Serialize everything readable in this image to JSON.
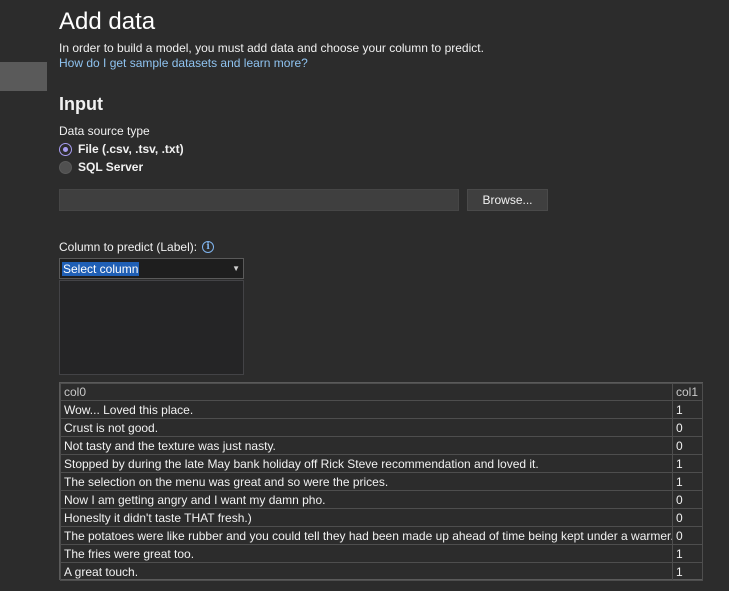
{
  "header": {
    "title": "Add data",
    "description": "In order to build a model, you must add data and choose your column to predict.",
    "help_link": "How do I get sample datasets and learn more?"
  },
  "input": {
    "section_title": "Input",
    "data_source_label": "Data source type",
    "options": [
      {
        "label": "File (.csv, .tsv, .txt)",
        "selected": true
      },
      {
        "label": "SQL Server",
        "selected": false
      }
    ],
    "file_path_value": "",
    "browse_label": "Browse...",
    "column_label": "Column to predict (Label):",
    "column_selected": "Select column"
  },
  "preview": {
    "columns": [
      "col0",
      "col1"
    ],
    "rows": [
      [
        "Wow... Loved this place.",
        "1"
      ],
      [
        "Crust is not good.",
        "0"
      ],
      [
        "Not tasty and the texture was just nasty.",
        "0"
      ],
      [
        "Stopped by during the late May bank holiday off Rick Steve recommendation and loved it.",
        "1"
      ],
      [
        "The selection on the menu was great and so were the prices.",
        "1"
      ],
      [
        "Now I am getting angry and I want my damn pho.",
        "0"
      ],
      [
        "Honeslty it didn't taste THAT fresh.)",
        "0"
      ],
      [
        "The potatoes were like rubber and you could tell they had been made up ahead of time being kept under a warmer.",
        "0"
      ],
      [
        "The fries were great too.",
        "1"
      ],
      [
        "A great touch.",
        "1"
      ]
    ]
  },
  "colors": {
    "background": "#2c2c2c",
    "link": "#8fc3f0",
    "radio_accent": "#a79cf0",
    "selection": "#1f5fb5"
  }
}
